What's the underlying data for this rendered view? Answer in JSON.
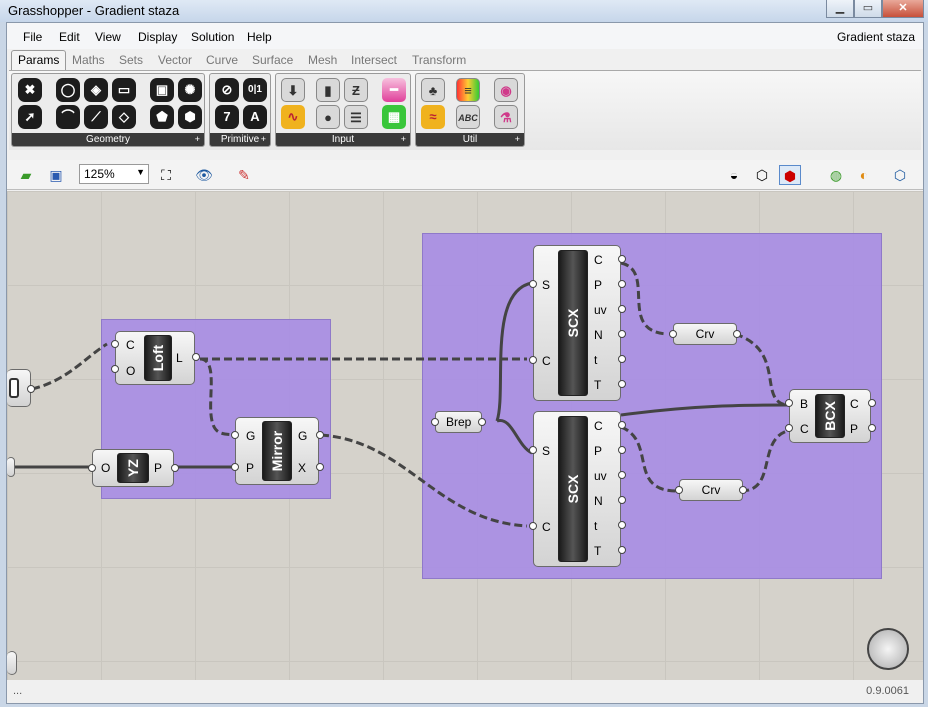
{
  "window": {
    "title": "Grasshopper - Gradient staza"
  },
  "menu": {
    "items": [
      "File",
      "Edit",
      "View",
      "Display",
      "Solution",
      "Help"
    ],
    "document": "Gradient staza"
  },
  "tabs": [
    "Params",
    "Maths",
    "Sets",
    "Vector",
    "Curve",
    "Surface",
    "Mesh",
    "Intersect",
    "Transform"
  ],
  "ribbon": {
    "groups": [
      "Geometry",
      "Primitive",
      "Input",
      "Util"
    ],
    "primitive_icons": [
      "0|1",
      "7",
      "A"
    ],
    "util_icon_text": "ABC"
  },
  "toolbar": {
    "zoom": "125%"
  },
  "canvas": {
    "loft": {
      "label": "Loft",
      "inputs": [
        "C",
        "O"
      ],
      "output": "L"
    },
    "mirror": {
      "label": "Mirror",
      "inputs": [
        "G",
        "P"
      ],
      "outputs": [
        "G",
        "X"
      ]
    },
    "yz": {
      "label": "YZ",
      "input": "O",
      "output": "P"
    },
    "brep": "Brep",
    "scx1": {
      "label": "SCX",
      "inputs": [
        "S",
        "C"
      ],
      "outputs": [
        "C",
        "P",
        "uv",
        "N",
        "t",
        "T"
      ]
    },
    "scx2": {
      "label": "SCX",
      "inputs": [
        "S",
        "C"
      ],
      "outputs": [
        "C",
        "P",
        "uv",
        "N",
        "t",
        "T"
      ]
    },
    "crv1": "Crv",
    "crv2": "Crv",
    "bcx": {
      "label": "BCX",
      "inputs": [
        "B",
        "C"
      ],
      "outputs": [
        "C",
        "P"
      ]
    }
  },
  "status": {
    "left": "...",
    "version": "0.9.0061"
  }
}
